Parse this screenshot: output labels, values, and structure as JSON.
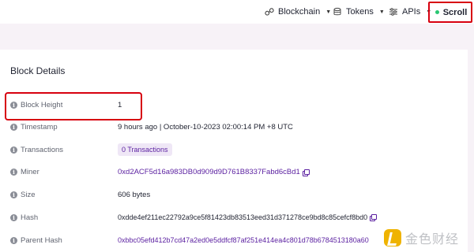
{
  "nav": {
    "items": [
      {
        "label": "Blockchain",
        "icon": "blockchain-link-icon"
      },
      {
        "label": "Tokens",
        "icon": "tokens-coins-icon"
      },
      {
        "label": "APIs",
        "icon": "apis-sliders-icon"
      }
    ],
    "network": {
      "label": "Scroll",
      "status_color": "#29c772"
    }
  },
  "card": {
    "title": "Block Details",
    "rows": [
      {
        "label": "Block Height",
        "value": "1"
      },
      {
        "label": "Timestamp",
        "value": "9 hours ago | October-10-2023 02:00:14 PM +8 UTC"
      },
      {
        "label": "Transactions",
        "value": "0 Transactions"
      },
      {
        "label": "Miner",
        "value": "0xd2ACF5d16a983DB0d909d9D761B8337Fabd6cBd1"
      },
      {
        "label": "Size",
        "value": "606 bytes"
      },
      {
        "label": "Hash",
        "value": "0xdde4ef211ec22792a9ce5f81423db83513eed31d371278ce9bd8c85cefcf8bd0"
      },
      {
        "label": "Parent Hash",
        "value": "0xbbc05efd412b7cd47a2ed0e5ddfcf87af251e414ea4c801d78b6784513180a60"
      }
    ]
  },
  "watermark": {
    "text": "金色财经"
  },
  "colors": {
    "accent": "#5a1fa0",
    "highlight": "#d7000f",
    "band": "#f7f2f7"
  }
}
